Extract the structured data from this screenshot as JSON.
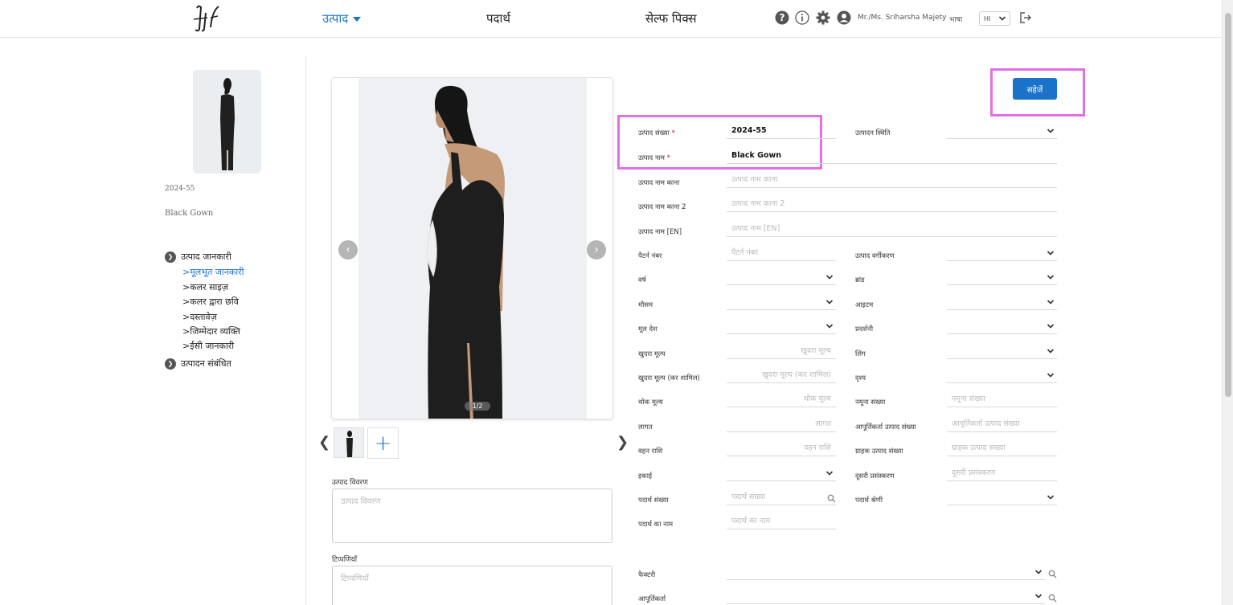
{
  "header": {
    "nav_products": "उत्पाद",
    "nav_materials": "पदार्थ",
    "nav_shelf": "सेल्फ पिक्स",
    "user_name": "Mr./Ms. Sriharsha Majety",
    "language_label": "भाषा",
    "language_value": "HI"
  },
  "sidebar": {
    "product_code": "2024-55",
    "product_name": "Black Gown",
    "sections": [
      {
        "label": "उत्पाद जानकारी"
      },
      {
        "label": "उत्पादन संबंधित"
      }
    ],
    "items": [
      {
        "label": ">मूलभूत जानकारी"
      },
      {
        "label": ">कलर साइज़"
      },
      {
        "label": ">कलर द्वारा छवि"
      },
      {
        "label": ">दस्तावेज़"
      },
      {
        "label": ">जिम्मेदार व्यक्ति"
      },
      {
        "label": ">ईसी जानकारी"
      }
    ]
  },
  "gallery": {
    "counter": "1/2"
  },
  "description": {
    "label": "उत्पाद विवरण",
    "placeholder": "उत्पाद विवरण"
  },
  "remarks": {
    "label": "टिप्पणियाँ",
    "placeholder": "टिप्पणियाँ"
  },
  "save_label": "सहेजें",
  "form": {
    "product_number": {
      "label": "उत्पाद संख्या",
      "value": "2024-55"
    },
    "product_name": {
      "label": "उत्पाद नाम",
      "value": "Black Gown"
    },
    "production_status": {
      "label": "उत्पादन स्थिति"
    },
    "name_kana": {
      "label": "उत्पाद नाम काना",
      "placeholder": "उत्पाद नाम काना"
    },
    "name_kana2": {
      "label": "उत्पाद नाम काना 2",
      "placeholder": "उत्पाद नाम काना 2"
    },
    "name_en": {
      "label": "उत्पाद नाम [EN]",
      "placeholder": "उत्पाद नाम [EN]"
    },
    "pattern_number": {
      "label": "पैटर्न नंबर",
      "placeholder": "पैटर्न नंबर"
    },
    "classification": {
      "label": "उत्पाद वर्गीकरण"
    },
    "year": {
      "label": "वर्ष"
    },
    "brand": {
      "label": "ब्रांड"
    },
    "season": {
      "label": "मौसम"
    },
    "item": {
      "label": "आइटम"
    },
    "origin": {
      "label": "मूल देश"
    },
    "exhibition": {
      "label": "प्रदर्शनी"
    },
    "retail_price": {
      "label": "खुदरा मूल्य",
      "placeholder": "खुदरा मूल्य"
    },
    "gender": {
      "label": "लिंग"
    },
    "retail_price_tax": {
      "label": "खुदरा मूल्य (कर शामिल)",
      "placeholder": "खुदरा मूल्य (कर शामिल)"
    },
    "scene": {
      "label": "दृश्य"
    },
    "wholesale_price": {
      "label": "थोक मूल्य",
      "placeholder": "थोक मूल्य"
    },
    "sample_number": {
      "label": "नमूना संख्या",
      "placeholder": "नमूना संख्या"
    },
    "cost": {
      "label": "लागत",
      "placeholder": "लागत"
    },
    "supplier_product_number": {
      "label": "आपूर्तिकर्ता उत्पाद संख्या",
      "placeholder": "आपूर्तिकर्ता उत्पाद संख्या"
    },
    "carrying_amount": {
      "label": "वहन राशि",
      "placeholder": "वहन राशि"
    },
    "customer_product_number": {
      "label": "ग्राहक उत्पाद संख्या",
      "placeholder": "ग्राहक उत्पाद संख्या"
    },
    "unit": {
      "label": "इकाई"
    },
    "second_processing": {
      "label": "दूसरी प्रसंस्करण",
      "placeholder": "दूसरी प्रसंस्करण"
    },
    "material_number": {
      "label": "पदार्थ संख्या",
      "placeholder": "पदार्थ संख्या"
    },
    "material_category": {
      "label": "पदार्थ श्रेणी"
    },
    "material_name": {
      "label": "पदार्थ का नाम",
      "placeholder": "पदार्थ का नाम"
    },
    "factory": {
      "label": "फैक्टरी"
    },
    "supplier": {
      "label": "आपूर्तिकर्ता"
    }
  },
  "colors": {
    "accent": "#1a73c8",
    "highlight": "#e26fe6"
  }
}
